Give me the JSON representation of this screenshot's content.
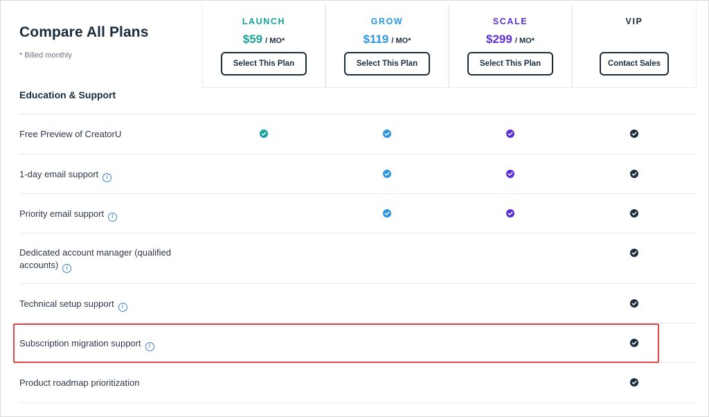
{
  "header": {
    "title": "Compare All Plans",
    "subtitle": "* Billed monthly",
    "section": "Education & Support"
  },
  "plans": [
    {
      "name": "LAUNCH",
      "price": "$59",
      "per": "/ MO*",
      "button": "Select This Plan",
      "color": "#14a39a"
    },
    {
      "name": "GROW",
      "price": "$119",
      "per": "/ MO*",
      "button": "Select This Plan",
      "color": "#2b95e0"
    },
    {
      "name": "SCALE",
      "price": "$299",
      "per": "/ MO*",
      "button": "Select This Plan",
      "color": "#5b2fd6"
    },
    {
      "name": "VIP",
      "price": "",
      "per": "",
      "button": "Contact Sales",
      "color": "#1a2b3c"
    }
  ],
  "features": [
    {
      "label": "Free Preview of CreatorU",
      "info": false,
      "checks": [
        true,
        true,
        true,
        true
      ]
    },
    {
      "label": "1-day email support",
      "info": true,
      "checks": [
        false,
        true,
        true,
        true
      ]
    },
    {
      "label": "Priority email support",
      "info": true,
      "checks": [
        false,
        true,
        true,
        true
      ]
    },
    {
      "label": "Dedicated account manager (qualified accounts)",
      "info": true,
      "checks": [
        false,
        false,
        false,
        true
      ]
    },
    {
      "label": "Technical setup support",
      "info": true,
      "checks": [
        false,
        false,
        false,
        true
      ]
    },
    {
      "label": "Subscription migration support",
      "info": true,
      "checks": [
        false,
        false,
        false,
        true
      ]
    },
    {
      "label": "Product roadmap prioritization",
      "info": false,
      "checks": [
        false,
        false,
        false,
        true
      ]
    }
  ],
  "icons": {
    "check": "check-circle-icon",
    "info": "info-icon"
  },
  "highlight_color": "#e04848"
}
